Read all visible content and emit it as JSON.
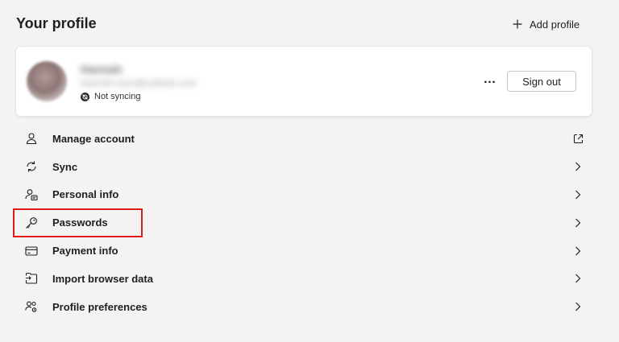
{
  "header": {
    "title": "Your profile",
    "add_profile_label": "Add profile"
  },
  "profile": {
    "name": "Hannah",
    "email": "hannah.user@outlook.com",
    "sync_status": "Not syncing",
    "more_label": "…",
    "sign_out_label": "Sign out"
  },
  "menu": {
    "items": [
      {
        "label": "Manage account",
        "icon": "person-icon",
        "trail": "external-link-icon"
      },
      {
        "label": "Sync",
        "icon": "sync-icon",
        "trail": "chevron-right-icon"
      },
      {
        "label": "Personal info",
        "icon": "personal-info-icon",
        "trail": "chevron-right-icon"
      },
      {
        "label": "Passwords",
        "icon": "key-icon",
        "trail": "chevron-right-icon",
        "highlighted": true
      },
      {
        "label": "Payment info",
        "icon": "credit-card-icon",
        "trail": "chevron-right-icon"
      },
      {
        "label": "Import browser data",
        "icon": "import-icon",
        "trail": "chevron-right-icon"
      },
      {
        "label": "Profile preferences",
        "icon": "people-settings-icon",
        "trail": "chevron-right-icon"
      }
    ]
  },
  "colors": {
    "background": "#f3f3f3",
    "card": "#ffffff",
    "highlight": "#e01a1a",
    "text": "#1f1f1f"
  }
}
